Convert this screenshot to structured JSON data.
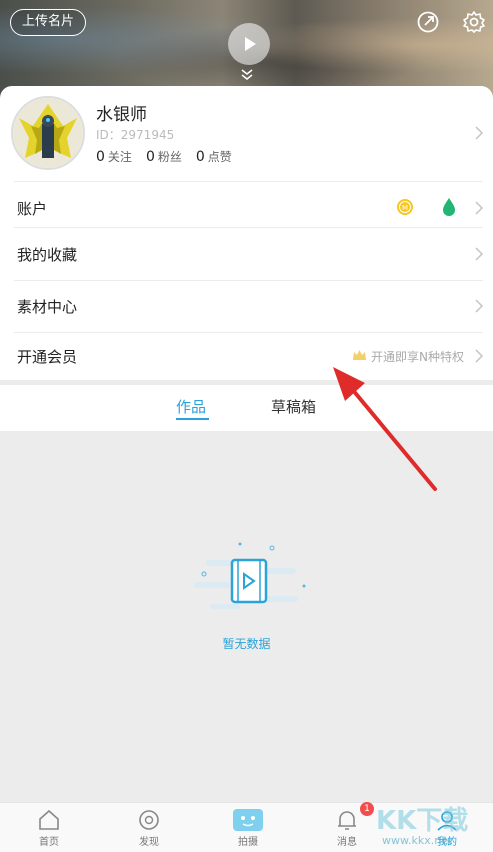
{
  "header": {
    "upload_label": "上传名片"
  },
  "profile": {
    "name": "水银师",
    "id_text": "ID：2971945",
    "stats": [
      {
        "value": "0",
        "label": "关注"
      },
      {
        "value": "0",
        "label": "粉丝"
      },
      {
        "value": "0",
        "label": "点赞"
      }
    ]
  },
  "menu": {
    "account": "账户",
    "favorites": "我的收藏",
    "materials": "素材中心",
    "vip": "开通会员",
    "vip_hint": "开通即享N种特权"
  },
  "tabs": {
    "works": "作品",
    "drafts": "草稿箱"
  },
  "empty": {
    "text": "暂无数据"
  },
  "nav": {
    "home": "首页",
    "discover": "发现",
    "shoot": "拍摄",
    "messages": "消息",
    "mine": "我的",
    "badge": "1"
  },
  "watermark": {
    "brand": "KK下载",
    "url": "www.kkx.net"
  },
  "colors": {
    "accent": "#2aa3d8",
    "arrow": "#e02b2b",
    "badge": "#f24c4c"
  }
}
